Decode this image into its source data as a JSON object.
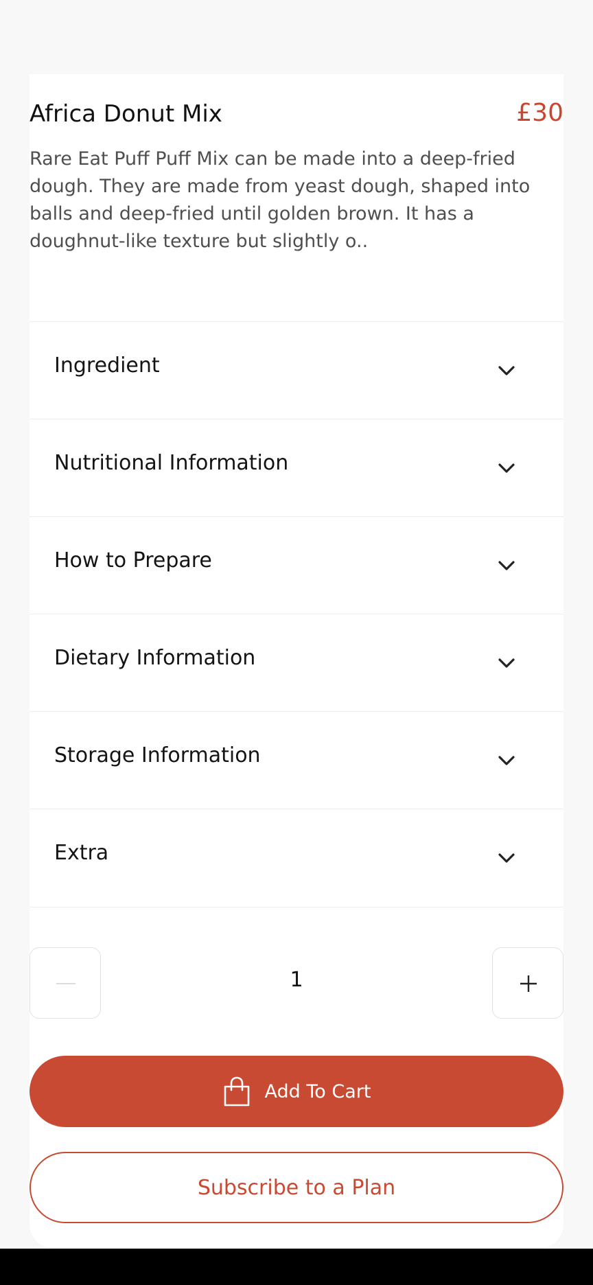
{
  "product": {
    "title": "Africa Donut Mix",
    "price": "£30",
    "description": "Rare Eat Puff Puff Mix can be made into a deep-fried dough. They are made from yeast dough, shaped into balls and deep-fried until golden brown. It has a doughnut-like texture but slightly o.."
  },
  "accordion": [
    {
      "label": "Ingredient",
      "icon": "chevron-down-icon"
    },
    {
      "label": "Nutritional Information",
      "icon": "chevron-down-icon"
    },
    {
      "label": "How to Prepare",
      "icon": "chevron-down-icon"
    },
    {
      "label": "Dietary Information",
      "icon": "chevron-down-icon"
    },
    {
      "label": "Storage Information",
      "icon": "chevron-down-icon"
    },
    {
      "label": "Extra",
      "icon": "chevron-down-icon"
    }
  ],
  "quantity": {
    "value": "1",
    "minus_icon": "minus-icon",
    "plus_icon": "plus-icon"
  },
  "actions": {
    "add_to_cart_label": "Add To Cart",
    "add_to_cart_icon": "shopping-bag-icon",
    "subscribe_label": "Subscribe to a Plan"
  },
  "colors": {
    "accent": "#c94a32",
    "background": "#f8f8f8",
    "card": "#ffffff"
  }
}
